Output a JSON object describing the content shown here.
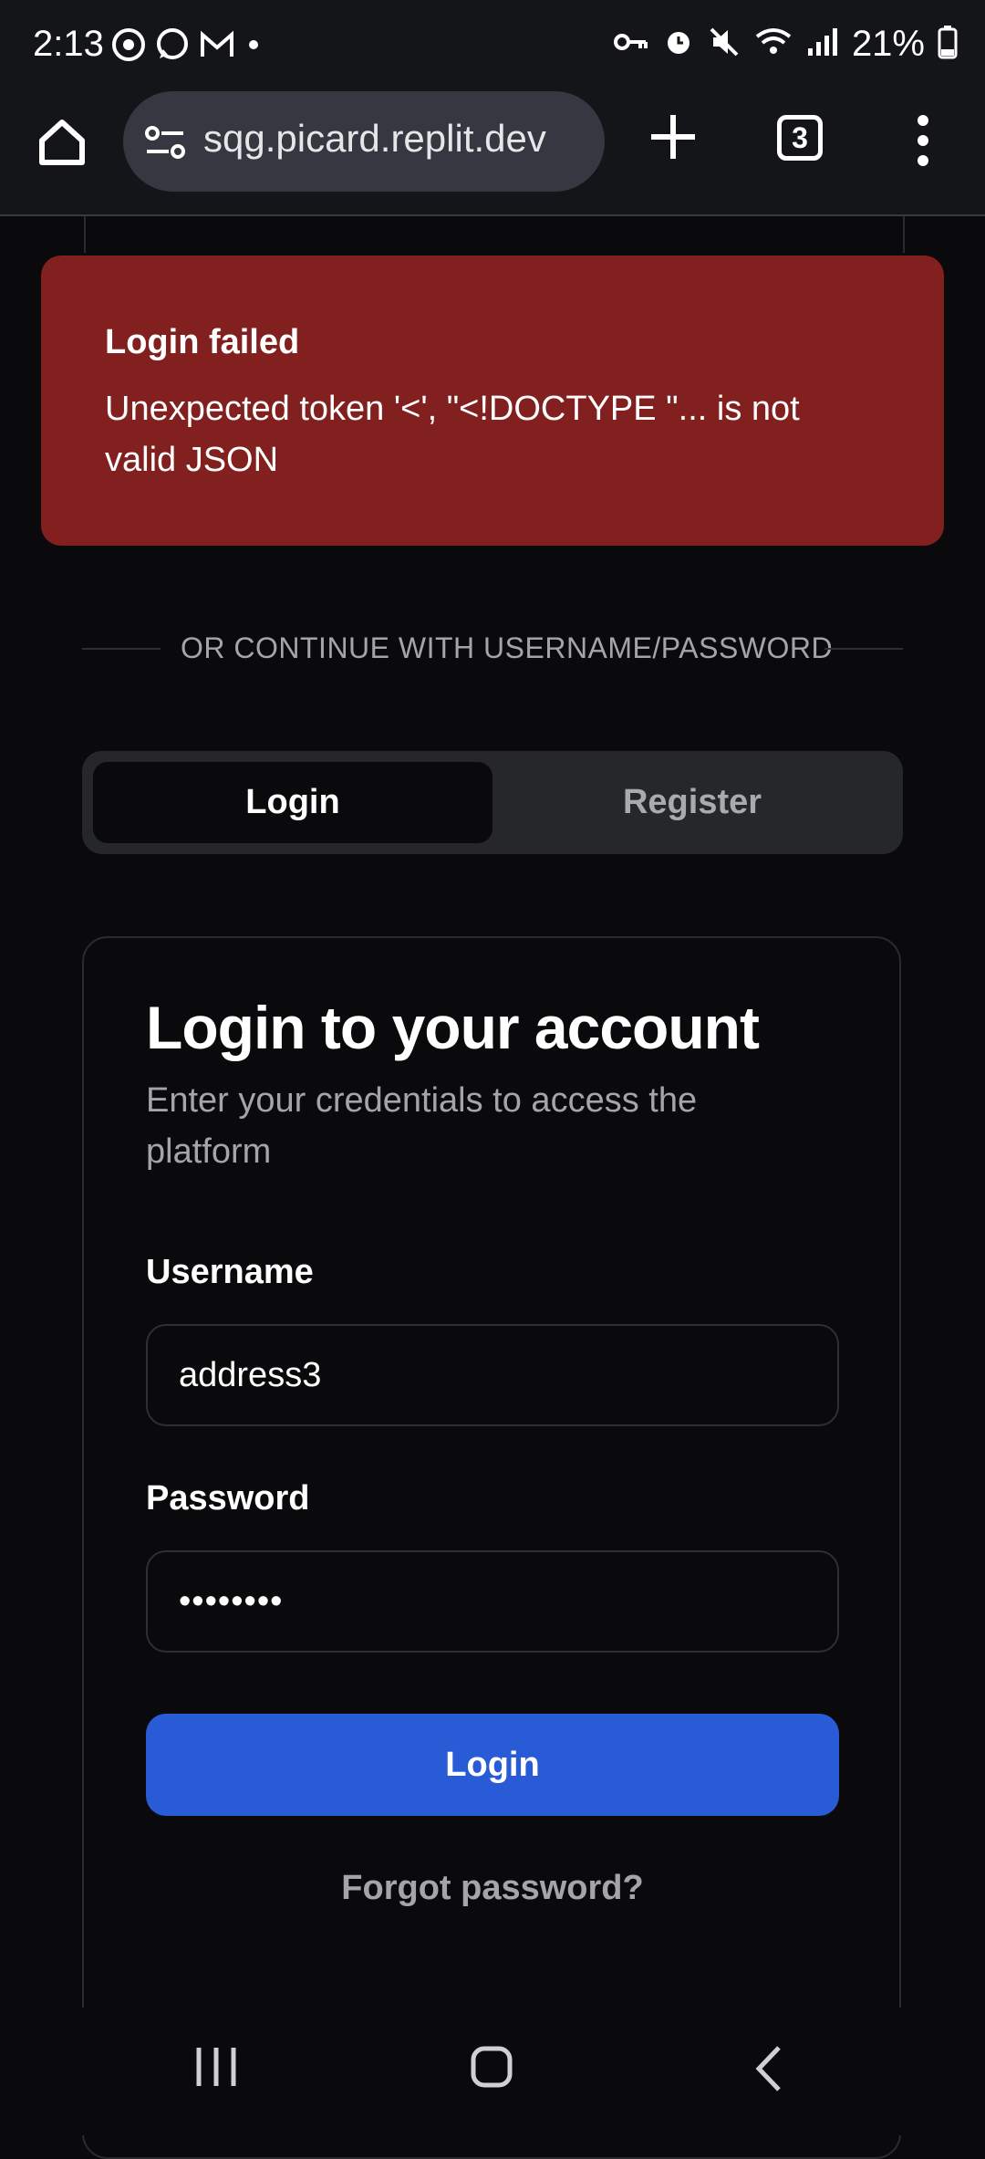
{
  "status_bar": {
    "time": "2:13",
    "battery": "21%",
    "left_icons": [
      "threads-icon",
      "whatsapp-icon",
      "gmail-icon",
      "dot-icon"
    ],
    "right_icons": [
      "key-icon",
      "alarm-icon",
      "mute-icon",
      "wifi-icon",
      "signal-icon",
      "battery-icon"
    ]
  },
  "browser": {
    "url": "sqg.picard.replit.dev",
    "tab_count": "3"
  },
  "toast": {
    "title": "Login failed",
    "message": "Unexpected token '<', \"<!DOCTYPE \"... is not valid JSON",
    "color": "#82201f"
  },
  "divider": {
    "text": "OR CONTINUE WITH USERNAME/PASSWORD"
  },
  "tabs": [
    {
      "label": "Login",
      "active": true
    },
    {
      "label": "Register",
      "active": false
    }
  ],
  "form": {
    "title": "Login to your account",
    "subtitle": "Enter your credentials to access the platform",
    "username_label": "Username",
    "username_value": "address3",
    "password_label": "Password",
    "password_value": "••••••••",
    "submit_label": "Login",
    "forgot_label": "Forgot password?",
    "accent_color": "#2a5bd7"
  },
  "nav": [
    "recents-icon",
    "home-icon",
    "back-icon"
  ]
}
